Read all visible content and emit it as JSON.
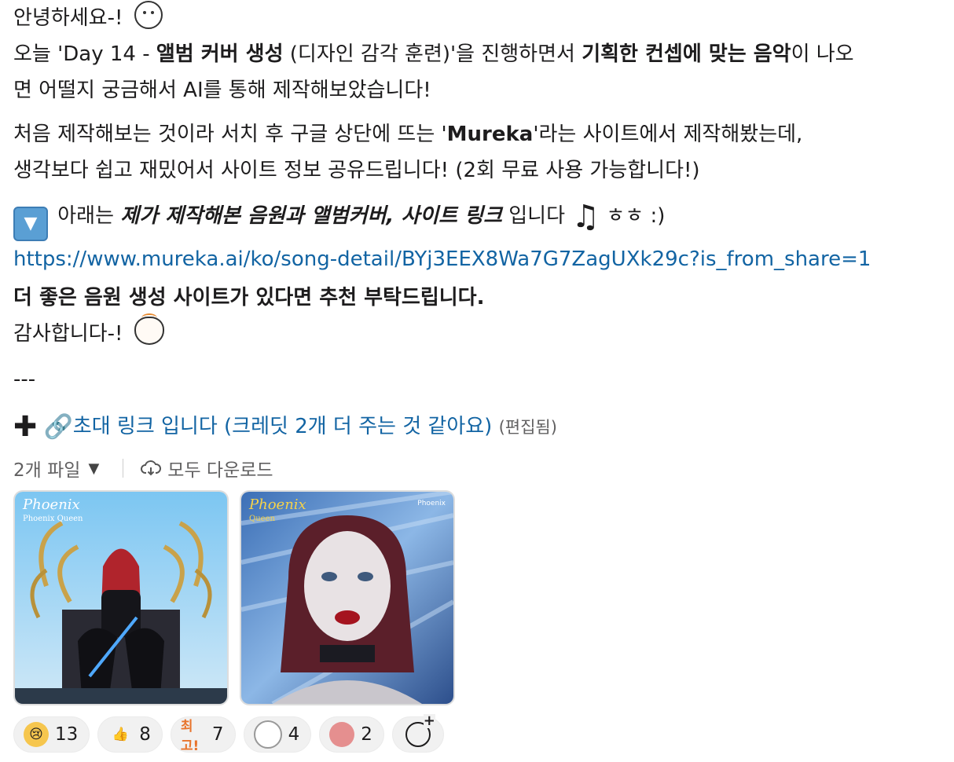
{
  "message": {
    "line1": "안녕하세요-!",
    "line2_pre": "오늘 'Day 14 - ",
    "line2_bold1": "앨범 커버 생성",
    "line2_mid": " (디자인 감각 훈련)'을 진행하면서 ",
    "line2_bold2": "기획한 컨셉에 맞는 음악",
    "line2_post": "이 나오",
    "line3": "면 어떨지 궁금해서 AI를 통해 제작해보았습니다!",
    "line4_pre": "처음 제작해보는 것이라 서치 후 구글 상단에 뜨는 '",
    "line4_bold": "Mureka",
    "line4_post": "'라는 사이트에서 제작해봤는데,",
    "line5": "생각보다 쉽고 재밌어서 사이트 정보 공유드립니다! (2회 무료 사용 가능합니다!)",
    "line6_pre": " 아래는 ",
    "line6_bi": "제가 제작해본 음원과 앨범커버, 사이트 링크",
    "line6_post": " 입니다",
    "line6_tail": " ㅎㅎ :)",
    "link_url": "https://www.mureka.ai/ko/song-detail/BYj3EEX8Wa7G7ZagUXk29c?is_from_share=1",
    "line8_bold": "더 좋은 음원 생성 사이트가 있다면 추천 부탁드립니다.",
    "line9": "감사합니다-!",
    "divider": "---",
    "invite_link": "초대 링크 입니다 (크레딧 2개 더 주는 것 같아요)",
    "edited": "(편집됨)"
  },
  "files": {
    "count_label": "2개 파일",
    "download_all": "모두 다운로드",
    "items": [
      {
        "brand": "Phoenix",
        "sub": "Phoenix Queen"
      },
      {
        "brand": "Phoenix",
        "sub": "Queen",
        "corner": "Phoenix"
      }
    ]
  },
  "reactions": [
    {
      "icon": "teary-face-icon",
      "count": "13"
    },
    {
      "icon": "thumbs-up-icon",
      "count": "8"
    },
    {
      "icon": "best-badge-icon",
      "label": "최고!",
      "count": "7"
    },
    {
      "icon": "cat-icon",
      "count": "4"
    },
    {
      "icon": "dog-icon",
      "count": "2"
    }
  ],
  "colors": {
    "link": "#1264a3",
    "text": "#1d1c1d",
    "muted": "#616061"
  }
}
